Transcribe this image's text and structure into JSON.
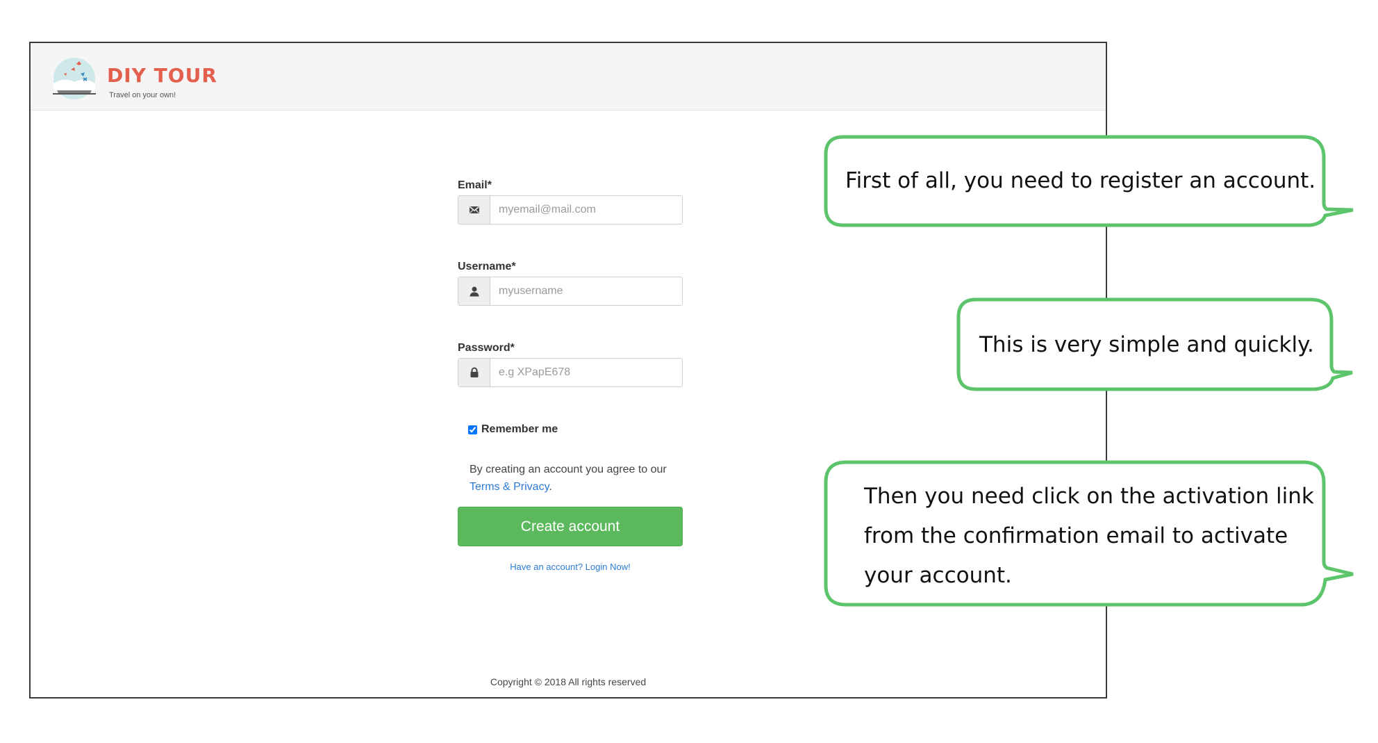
{
  "header": {
    "brand_name": "DIY TOUR",
    "tagline": "Travel on your own!"
  },
  "form": {
    "email": {
      "label": "Email*",
      "placeholder": "myemail@mail.com",
      "icon": "envelope-icon"
    },
    "username": {
      "label": "Username*",
      "placeholder": "myusername",
      "icon": "user-icon"
    },
    "password": {
      "label": "Password*",
      "placeholder": "e.g XPapE678",
      "icon": "lock-icon"
    },
    "remember_me": {
      "label": "Remember me",
      "checked": true
    },
    "terms_prefix": "By creating an account you agree to our ",
    "terms_link": "Terms & Privacy",
    "terms_suffix": ".",
    "create_button": "Create account",
    "login_link": "Have an account? Login Now!"
  },
  "footer": {
    "copyright": "Copyright © 2018 All rights reserved"
  },
  "callouts": [
    {
      "lines": [
        "First of all, you need to register an account."
      ]
    },
    {
      "lines": [
        "This is very simple and quickly."
      ]
    },
    {
      "lines": [
        "Then you need click on the activation link",
        "from the confirmation email to activate",
        "your account."
      ]
    }
  ],
  "colors": {
    "brand": "#e4604e",
    "button": "#5cb85c",
    "link": "#2b7bd6",
    "callout_border": "#5cc46a"
  }
}
